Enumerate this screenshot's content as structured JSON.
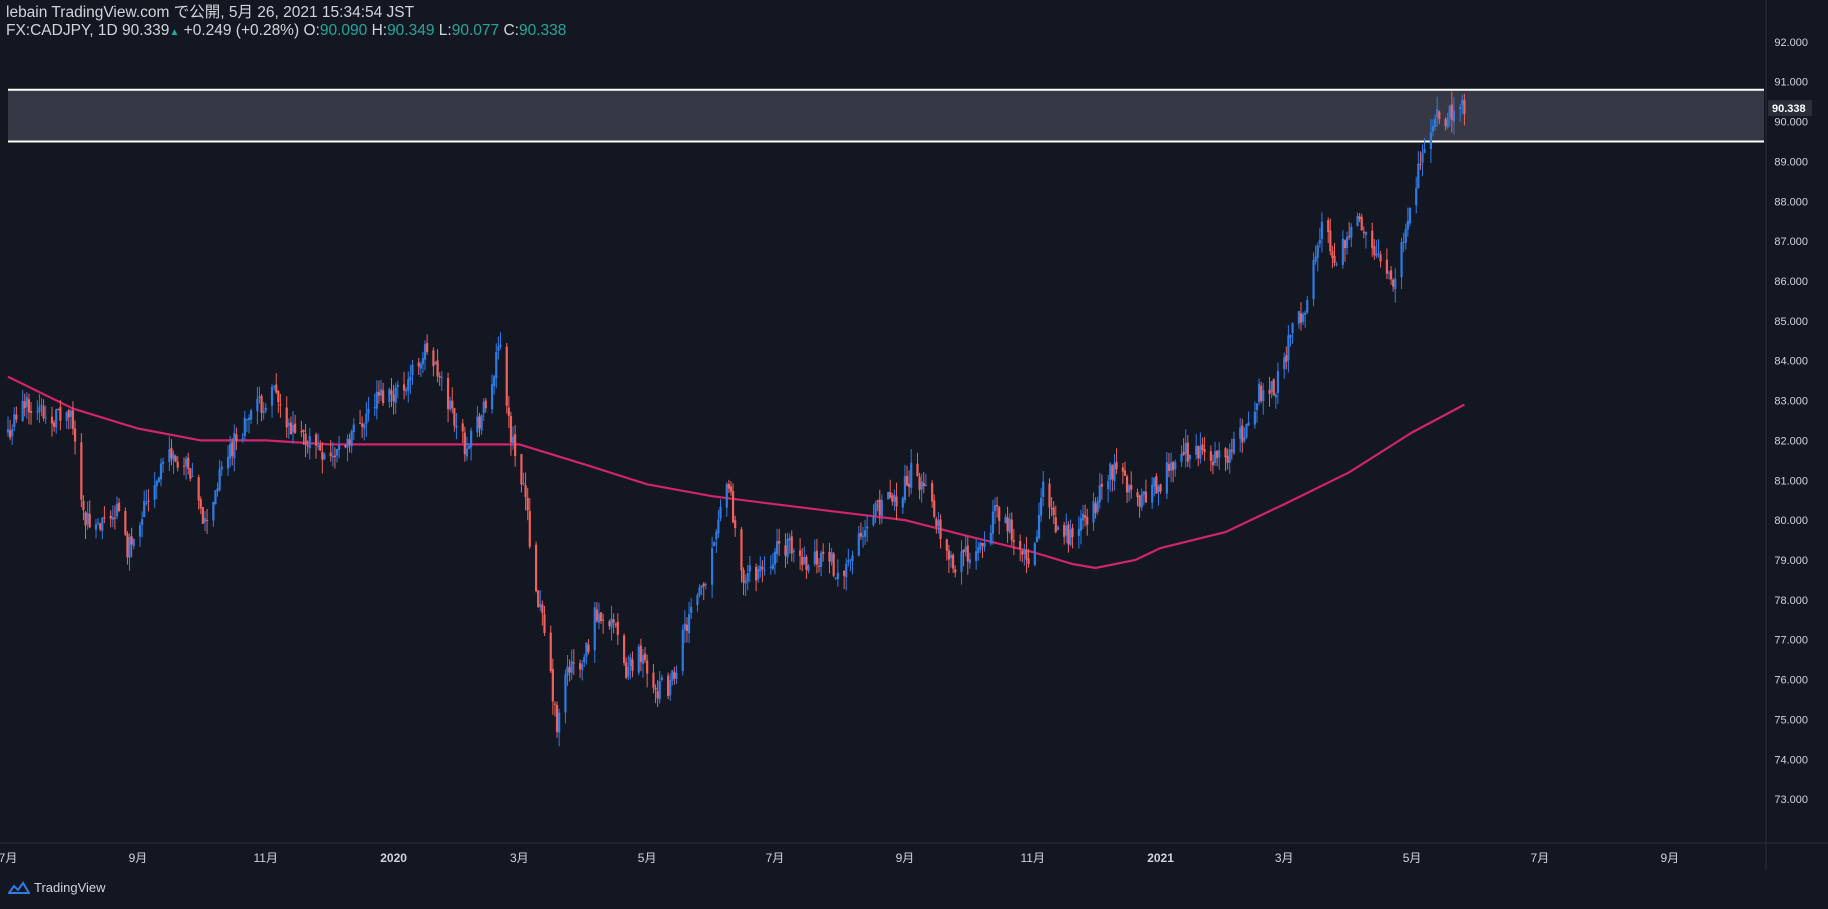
{
  "header": {
    "publisher": "lebain TradingView.com で公開, 5月 26, 2021 15:34:54 JST",
    "symbol": "FX:CADJPY, 1D",
    "last": "90.339",
    "up_icon": "triangle-up-icon",
    "change": "+0.249 (+0.28%)",
    "o_label": "O:",
    "o_val": "90.090",
    "h_label": "H:",
    "h_val": "90.349",
    "l_label": "L:",
    "l_val": "90.077",
    "c_label": "C:",
    "c_val": "90.338"
  },
  "footer": {
    "brand": "TradingView",
    "logo_icon": "tradingview-logo-icon"
  },
  "colors": {
    "background": "#131722",
    "up": "#2f7be4",
    "down": "#f0605c",
    "ma": "#d1246a",
    "zone": "#434651",
    "zone_border": "#ffffff",
    "text": "#d1d4dc",
    "value": "#26a69a"
  },
  "chart_data": {
    "type": "candlestick",
    "symbol": "FX:CADJPY",
    "interval": "1D",
    "current_price_label": "90.338",
    "y_axis": {
      "ticks": [
        "73.000",
        "74.000",
        "75.000",
        "76.000",
        "77.000",
        "78.000",
        "79.000",
        "80.000",
        "81.000",
        "82.000",
        "83.000",
        "84.000",
        "85.000",
        "86.000",
        "87.000",
        "88.000",
        "89.000",
        "90.000",
        "91.000",
        "92.000"
      ],
      "range": [
        72.1,
        92.8
      ]
    },
    "x_axis": {
      "ticks": [
        {
          "label": "7月",
          "date": "2019-07-01"
        },
        {
          "label": "9月",
          "date": "2019-09-01"
        },
        {
          "label": "11月",
          "date": "2019-11-01"
        },
        {
          "label": "2020",
          "date": "2020-01-01"
        },
        {
          "label": "3月",
          "date": "2020-03-01"
        },
        {
          "label": "5月",
          "date": "2020-05-01"
        },
        {
          "label": "7月",
          "date": "2020-07-01"
        },
        {
          "label": "9月",
          "date": "2020-09-01"
        },
        {
          "label": "11月",
          "date": "2020-11-01"
        },
        {
          "label": "2021",
          "date": "2021-01-01"
        },
        {
          "label": "3月",
          "date": "2021-03-01"
        },
        {
          "label": "5月",
          "date": "2021-05-01"
        },
        {
          "label": "7月",
          "date": "2021-07-01"
        },
        {
          "label": "9月",
          "date": "2021-09-01"
        }
      ],
      "range": [
        "2019-07-01",
        "2021-10-15"
      ]
    },
    "price_path": [
      [
        "2019-07-01",
        82.2
      ],
      [
        "2019-07-10",
        83.0
      ],
      [
        "2019-07-20",
        82.6
      ],
      [
        "2019-07-31",
        82.6
      ],
      [
        "2019-08-07",
        80.0
      ],
      [
        "2019-08-13",
        79.7
      ],
      [
        "2019-08-22",
        80.3
      ],
      [
        "2019-08-27",
        79.3
      ],
      [
        "2019-09-05",
        80.5
      ],
      [
        "2019-09-15",
        81.7
      ],
      [
        "2019-09-24",
        81.3
      ],
      [
        "2019-10-03",
        79.9
      ],
      [
        "2019-10-14",
        81.7
      ],
      [
        "2019-10-25",
        82.7
      ],
      [
        "2019-11-05",
        83.2
      ],
      [
        "2019-11-12",
        82.2
      ],
      [
        "2019-11-22",
        82.0
      ],
      [
        "2019-12-03",
        81.6
      ],
      [
        "2019-12-14",
        82.3
      ],
      [
        "2019-12-25",
        83.1
      ],
      [
        "2020-01-05",
        83.3
      ],
      [
        "2020-01-17",
        84.3
      ],
      [
        "2020-01-27",
        83.0
      ],
      [
        "2020-02-04",
        81.9
      ],
      [
        "2020-02-14",
        82.8
      ],
      [
        "2020-02-21",
        84.4
      ],
      [
        "2020-02-26",
        82.1
      ],
      [
        "2020-03-03",
        80.9
      ],
      [
        "2020-03-09",
        78.3
      ],
      [
        "2020-03-15",
        76.5
      ],
      [
        "2020-03-19",
        74.7
      ],
      [
        "2020-03-24",
        76.3
      ],
      [
        "2020-03-31",
        76.3
      ],
      [
        "2020-04-06",
        77.6
      ],
      [
        "2020-04-14",
        77.6
      ],
      [
        "2020-04-20",
        76.2
      ],
      [
        "2020-04-28",
        76.7
      ],
      [
        "2020-05-05",
        75.8
      ],
      [
        "2020-05-12",
        75.8
      ],
      [
        "2020-05-20",
        77.4
      ],
      [
        "2020-05-28",
        78.3
      ],
      [
        "2020-06-05",
        80.4
      ],
      [
        "2020-06-09",
        81.0
      ],
      [
        "2020-06-15",
        78.5
      ],
      [
        "2020-06-25",
        78.8
      ],
      [
        "2020-07-05",
        79.4
      ],
      [
        "2020-07-15",
        79.0
      ],
      [
        "2020-07-25",
        79.1
      ],
      [
        "2020-08-01",
        78.7
      ],
      [
        "2020-08-10",
        79.4
      ],
      [
        "2020-08-20",
        80.4
      ],
      [
        "2020-08-28",
        80.5
      ],
      [
        "2020-09-05",
        81.3
      ],
      [
        "2020-09-14",
        80.4
      ],
      [
        "2020-09-24",
        78.9
      ],
      [
        "2020-10-05",
        79.3
      ],
      [
        "2020-10-15",
        80.2
      ],
      [
        "2020-10-23",
        79.7
      ],
      [
        "2020-10-31",
        78.6
      ],
      [
        "2020-11-06",
        80.8
      ],
      [
        "2020-11-12",
        79.7
      ],
      [
        "2020-11-20",
        79.6
      ],
      [
        "2020-11-30",
        80.3
      ],
      [
        "2020-12-10",
        81.4
      ],
      [
        "2020-12-21",
        80.5
      ],
      [
        "2020-12-31",
        80.9
      ],
      [
        "2021-01-10",
        81.7
      ],
      [
        "2021-01-20",
        81.7
      ],
      [
        "2021-01-31",
        81.5
      ],
      [
        "2021-02-10",
        82.2
      ],
      [
        "2021-02-17",
        83.2
      ],
      [
        "2021-02-25",
        83.4
      ],
      [
        "2021-03-05",
        84.7
      ],
      [
        "2021-03-12",
        85.5
      ],
      [
        "2021-03-19",
        87.4
      ],
      [
        "2021-03-26",
        86.5
      ],
      [
        "2021-04-03",
        87.6
      ],
      [
        "2021-04-08",
        87.2
      ],
      [
        "2021-04-16",
        86.7
      ],
      [
        "2021-04-22",
        86.0
      ],
      [
        "2021-04-30",
        88.0
      ],
      [
        "2021-05-08",
        89.5
      ],
      [
        "2021-05-13",
        90.1
      ],
      [
        "2021-05-20",
        90.2
      ],
      [
        "2021-05-26",
        90.34
      ]
    ],
    "ma200": [
      [
        "2019-07-01",
        83.6
      ],
      [
        "2019-08-01",
        82.8
      ],
      [
        "2019-09-01",
        82.3
      ],
      [
        "2019-10-01",
        82.0
      ],
      [
        "2019-11-01",
        82.0
      ],
      [
        "2019-12-01",
        81.9
      ],
      [
        "2020-01-01",
        81.9
      ],
      [
        "2020-02-01",
        81.9
      ],
      [
        "2020-03-01",
        81.9
      ],
      [
        "2020-04-01",
        81.4
      ],
      [
        "2020-05-01",
        80.9
      ],
      [
        "2020-06-01",
        80.6
      ],
      [
        "2020-07-01",
        80.4
      ],
      [
        "2020-08-01",
        80.2
      ],
      [
        "2020-09-01",
        80.0
      ],
      [
        "2020-10-01",
        79.6
      ],
      [
        "2020-11-01",
        79.2
      ],
      [
        "2020-11-20",
        78.9
      ],
      [
        "2020-12-01",
        78.8
      ],
      [
        "2020-12-20",
        79.0
      ],
      [
        "2021-01-01",
        79.3
      ],
      [
        "2021-02-01",
        79.7
      ],
      [
        "2021-03-01",
        80.4
      ],
      [
        "2021-04-01",
        81.2
      ],
      [
        "2021-05-01",
        82.2
      ],
      [
        "2021-05-26",
        82.9
      ]
    ],
    "zone": {
      "top": 90.8,
      "bottom": 89.5
    },
    "grid": false,
    "legend": "none"
  }
}
